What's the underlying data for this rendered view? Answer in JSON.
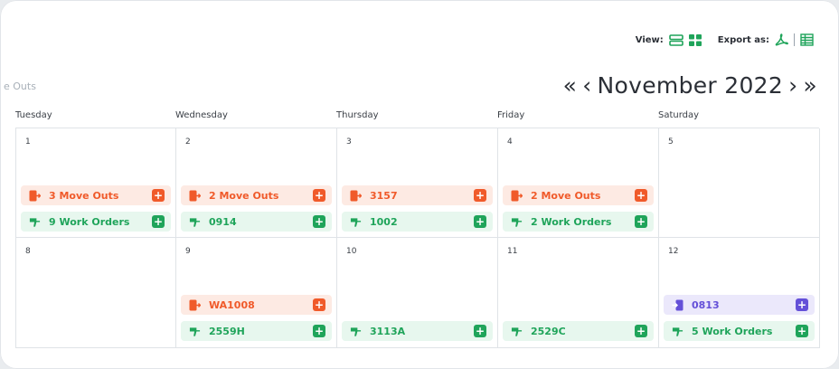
{
  "toolbar": {
    "view_label": "View:",
    "export_label": "Export as:"
  },
  "filter": {
    "label": "e Outs"
  },
  "nav": {
    "first": "«",
    "prev": "‹",
    "month": "November 2022",
    "next": "›",
    "last": "»"
  },
  "weekdays": [
    "Tuesday",
    "Wednesday",
    "Thursday",
    "Friday",
    "Saturday"
  ],
  "colors": {
    "move_out": "#f05a2a",
    "work_order": "#1fa45a",
    "move_in": "#6450d8"
  },
  "days": [
    {
      "num": "1",
      "events": [
        {
          "type": "out",
          "label": "3 Move Outs"
        },
        {
          "type": "wo",
          "label": "9 Work Orders"
        }
      ]
    },
    {
      "num": "2",
      "events": [
        {
          "type": "out",
          "label": "2 Move Outs"
        },
        {
          "type": "wo",
          "label": "0914"
        }
      ]
    },
    {
      "num": "3",
      "events": [
        {
          "type": "out",
          "label": "3157"
        },
        {
          "type": "wo",
          "label": "1002"
        }
      ]
    },
    {
      "num": "4",
      "events": [
        {
          "type": "out",
          "label": "2 Move Outs"
        },
        {
          "type": "wo",
          "label": "2 Work Orders"
        }
      ]
    },
    {
      "num": "5",
      "events": []
    },
    {
      "num": "8",
      "events": []
    },
    {
      "num": "9",
      "events": [
        {
          "type": "out",
          "label": "WA1008"
        },
        {
          "type": "wo",
          "label": "2559H"
        }
      ]
    },
    {
      "num": "10",
      "events": [
        {
          "type": "wo",
          "label": "3113A"
        }
      ]
    },
    {
      "num": "11",
      "events": [
        {
          "type": "wo",
          "label": "2529C"
        }
      ]
    },
    {
      "num": "12",
      "events": [
        {
          "type": "in",
          "label": "0813"
        },
        {
          "type": "wo",
          "label": "5 Work Orders"
        }
      ]
    }
  ]
}
